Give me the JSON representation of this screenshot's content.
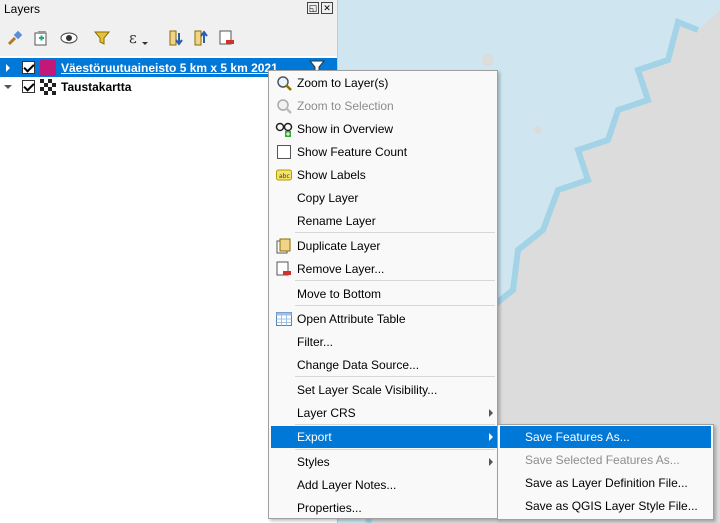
{
  "panel": {
    "title": "Layers",
    "float_glyph": "◱",
    "close_glyph": "✕",
    "toolbar_icons": [
      "style-brush-icon",
      "add-group-icon",
      "visibility-eye-icon",
      "filter-icon",
      "expression-filter-icon",
      "expand-all-icon",
      "collapse-all-icon",
      "remove-layer-icon"
    ]
  },
  "layers": [
    {
      "label": "Väestöruutuaineisto 5 km x 5 km 2021",
      "checked": true,
      "selected": true,
      "swatch": "#c2187a"
    },
    {
      "label": "Taustakartta",
      "checked": true,
      "selected": false
    }
  ],
  "context_menu": {
    "items": [
      {
        "label": "Zoom to Layer(s)",
        "icon": "zoom-layer-icon",
        "disabled": false
      },
      {
        "label": "Zoom to Selection",
        "icon": "zoom-selection-icon",
        "disabled": true
      },
      {
        "label": "Show in Overview",
        "icon": "overview-icon",
        "disabled": false
      },
      {
        "label": "Show Feature Count",
        "icon": "feature-count-checkbox-icon",
        "disabled": false
      },
      {
        "label": "Show Labels",
        "icon": "labels-icon",
        "disabled": false
      },
      {
        "label": "Copy Layer",
        "icon": "",
        "disabled": false
      },
      {
        "label": "Rename Layer",
        "icon": "",
        "disabled": false
      },
      {
        "label": "Duplicate Layer",
        "icon": "duplicate-icon",
        "disabled": false
      },
      {
        "label": "Remove Layer...",
        "icon": "remove-icon",
        "disabled": false
      },
      {
        "label": "Move to Bottom",
        "icon": "",
        "disabled": false
      },
      {
        "label": "Open Attribute Table",
        "icon": "attribute-table-icon",
        "disabled": false
      },
      {
        "label": "Filter...",
        "icon": "",
        "disabled": false
      },
      {
        "label": "Change Data Source...",
        "icon": "",
        "disabled": false
      },
      {
        "label": "Set Layer Scale Visibility...",
        "icon": "",
        "disabled": false
      },
      {
        "label": "Layer CRS",
        "icon": "",
        "disabled": false,
        "submenu": true
      },
      {
        "label": "Export",
        "icon": "",
        "disabled": false,
        "submenu": true,
        "highlighted": true
      },
      {
        "label": "Styles",
        "icon": "",
        "disabled": false,
        "submenu": true
      },
      {
        "label": "Add Layer Notes...",
        "icon": "",
        "disabled": false
      },
      {
        "label": "Properties...",
        "icon": "",
        "disabled": false
      }
    ]
  },
  "export_submenu": {
    "items": [
      {
        "label": "Save Features As...",
        "highlighted": true,
        "disabled": false
      },
      {
        "label": "Save Selected Features As...",
        "highlighted": false,
        "disabled": true
      },
      {
        "label": "Save as Layer Definition File...",
        "highlighted": false,
        "disabled": false
      },
      {
        "label": "Save as QGIS Layer Style File...",
        "highlighted": false,
        "disabled": false
      }
    ]
  },
  "colors": {
    "accent": "#0078d7",
    "water": "#cfe6f1",
    "land": "#dcdcdc",
    "coast": "#a3d3e6"
  }
}
